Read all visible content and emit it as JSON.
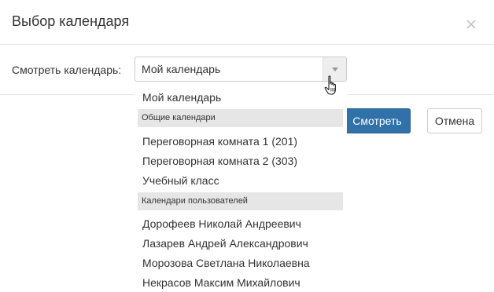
{
  "dialog": {
    "title": "Выбор календаря",
    "close_icon": "close-icon"
  },
  "form": {
    "label": "Смотреть календарь:",
    "select_value": "Мой календарь"
  },
  "buttons": {
    "view": "Смотреть",
    "cancel": "Отмена"
  },
  "dropdown": {
    "first_item": "Мой календарь",
    "groups": [
      {
        "label": "Общие календари",
        "items": [
          "Переговорная комната 1 (201)",
          "Переговорная комната 2 (303)",
          "Учебный класс"
        ]
      },
      {
        "label": "Календари пользователей",
        "items": [
          "Дорофеев Николай Андреевич",
          "Лазарев Андрей Александрович",
          "Морозова Светлана Николаевна",
          "Некрасов Максим Михайлович"
        ]
      }
    ]
  },
  "colors": {
    "primary": "#3071a9",
    "group_bg": "#e6e6e6"
  }
}
